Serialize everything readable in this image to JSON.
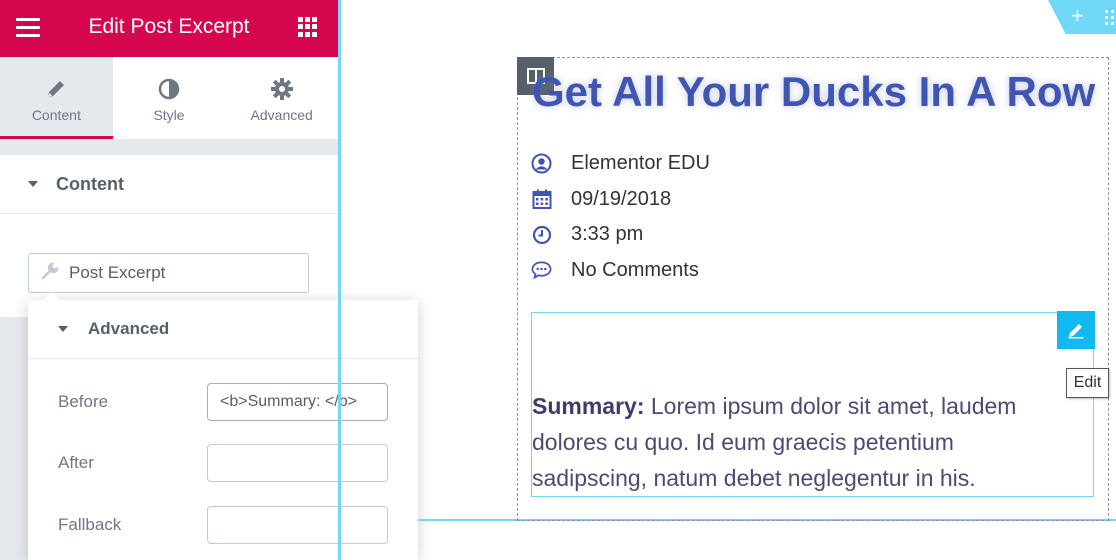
{
  "panel": {
    "title": "Edit Post Excerpt",
    "tabs": [
      {
        "label": "Content",
        "icon": "pencil-icon",
        "active": true
      },
      {
        "label": "Style",
        "icon": "contrast-icon",
        "active": false
      },
      {
        "label": "Advanced",
        "icon": "gear-icon",
        "active": false
      }
    ],
    "section_title": "Content",
    "dynamic_tag_label": "Post Excerpt",
    "popover": {
      "title": "Advanced",
      "fields": [
        {
          "label": "Before",
          "value": "<b>Summary: </b>"
        },
        {
          "label": "After",
          "value": ""
        },
        {
          "label": "Fallback",
          "value": ""
        }
      ]
    }
  },
  "colors": {
    "brand": "#d5064e",
    "accent": "#71d7f7",
    "edit_button": "#12b9ef",
    "title": "#4054b2"
  },
  "preview": {
    "post_title": "Get All Your Ducks In A Row",
    "meta": [
      {
        "icon": "user-circle-icon",
        "text": "Elementor EDU"
      },
      {
        "icon": "calendar-icon",
        "text": "09/19/2018"
      },
      {
        "icon": "clock-icon",
        "text": "3:33 pm"
      },
      {
        "icon": "comment-icon",
        "text": "No Comments"
      }
    ],
    "excerpt_prefix": "Summary:",
    "excerpt_text": " Lorem ipsum dolor sit amet, laudem dolores cu quo. Id eum graecis petentium sadipscing, natum debet neglegentur in his.",
    "edit_tooltip": "Edit"
  }
}
